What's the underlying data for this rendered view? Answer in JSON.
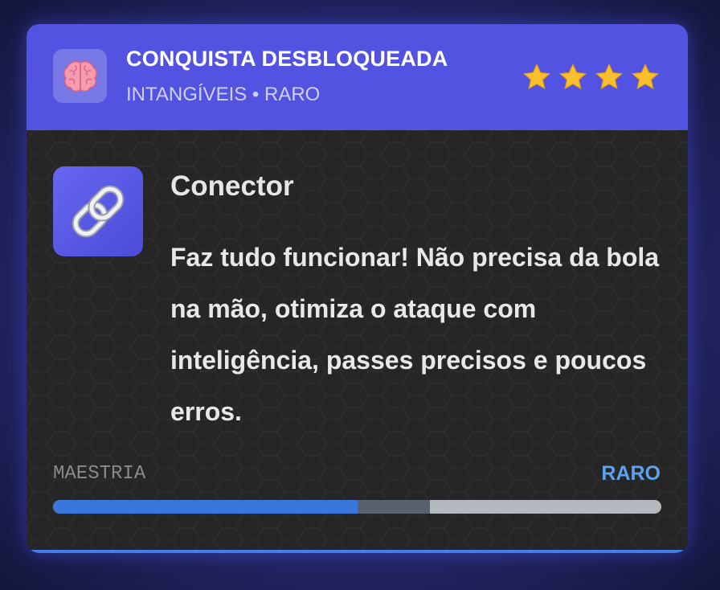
{
  "header": {
    "icon": "brain-icon",
    "title": "CONQUISTA DESBLOQUEADA",
    "subtitle": "INTANGÍVEIS • RARO",
    "stars": 4
  },
  "achievement": {
    "icon": "link-icon",
    "name": "Conector",
    "description": "Faz tudo funcionar! Não precisa da bola na mão, otimiza o ataque com inteligência, passes precisos e poucos erros."
  },
  "mastery": {
    "label": "MAESTRIA",
    "level": "RARO",
    "progress_fraction": 0.5,
    "next_segment_fraction": 0.12
  },
  "colors": {
    "header_bg": "#5253e0",
    "body_bg": "#262626",
    "accent_blue": "#3a77dc",
    "level_text": "#5fa2ea",
    "star": "#f7c12e"
  }
}
